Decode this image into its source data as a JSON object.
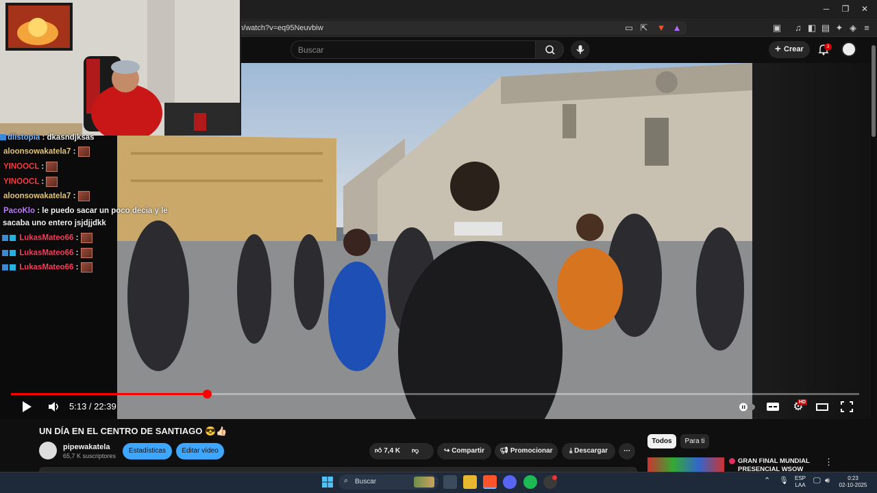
{
  "browser": {
    "url": "m/watch?v=eq95Neuvbiw"
  },
  "youtube": {
    "search_placeholder": "Buscar",
    "create_label": "Crear",
    "notification_count": "3"
  },
  "chat": [
    {
      "user": "dlistopia",
      "msg": "dkasndjksas",
      "user_color": "#7ab8ff"
    },
    {
      "user": "aloonsowakatela7",
      "msg": "",
      "user_color": "#e6c87a",
      "emote": true
    },
    {
      "user": "YINOOCL",
      "msg": "",
      "user_color": "#ff3b3b",
      "emote": true
    },
    {
      "user": "YINOOCL",
      "msg": "",
      "user_color": "#ff3b3b",
      "emote": true
    },
    {
      "user": "aloonsowakatela7",
      "msg": "",
      "user_color": "#e6c87a",
      "emote": true
    },
    {
      "user": "PacoKlo",
      "msg": "le puedo sacar un poco decia y le",
      "msg2": "sacaba uno entero jsjdjjdkk",
      "user_color": "#c07cff"
    },
    {
      "user": "LukasMateo66",
      "msg": "",
      "user_color": "#ff3b5b",
      "emote": true
    },
    {
      "user": "LukasMateo66",
      "msg": "",
      "user_color": "#ff3b5b",
      "emote": true
    },
    {
      "user": "LukasMateo66",
      "msg": "",
      "user_color": "#ff3b5b",
      "emote": true
    }
  ],
  "player": {
    "current_time": "5:13",
    "duration": "22:39",
    "time_display": "5:13 / 22:39",
    "progress_fraction": 0.231,
    "hd_badge": "HD"
  },
  "video": {
    "title": "UN DÍA EN EL CENTRO DE SANTIAGO 😎👍🏻",
    "channel": "pipewakatela",
    "subscribers": "65,7 K suscriptores",
    "btn_stats": "Estadísticas",
    "btn_edit": "Editar vídeo",
    "likes": "7,4 K",
    "share": "Compartir",
    "promote": "Promocionar",
    "download": "Descargar",
    "more": "⋯"
  },
  "sidebar": {
    "chips": [
      "Todos",
      "Para ti"
    ],
    "rec_title": "GRAN FINAL MUNDIAL PRESENCIAL WSOW"
  },
  "taskbar": {
    "search_label": "Buscar",
    "lang_top": "ESP",
    "lang_bottom": "LAA",
    "time": "0:23",
    "date": "02-10-2025"
  },
  "colors": {
    "accent_red": "#ff0000",
    "blue_button": "#3ea6ff"
  }
}
